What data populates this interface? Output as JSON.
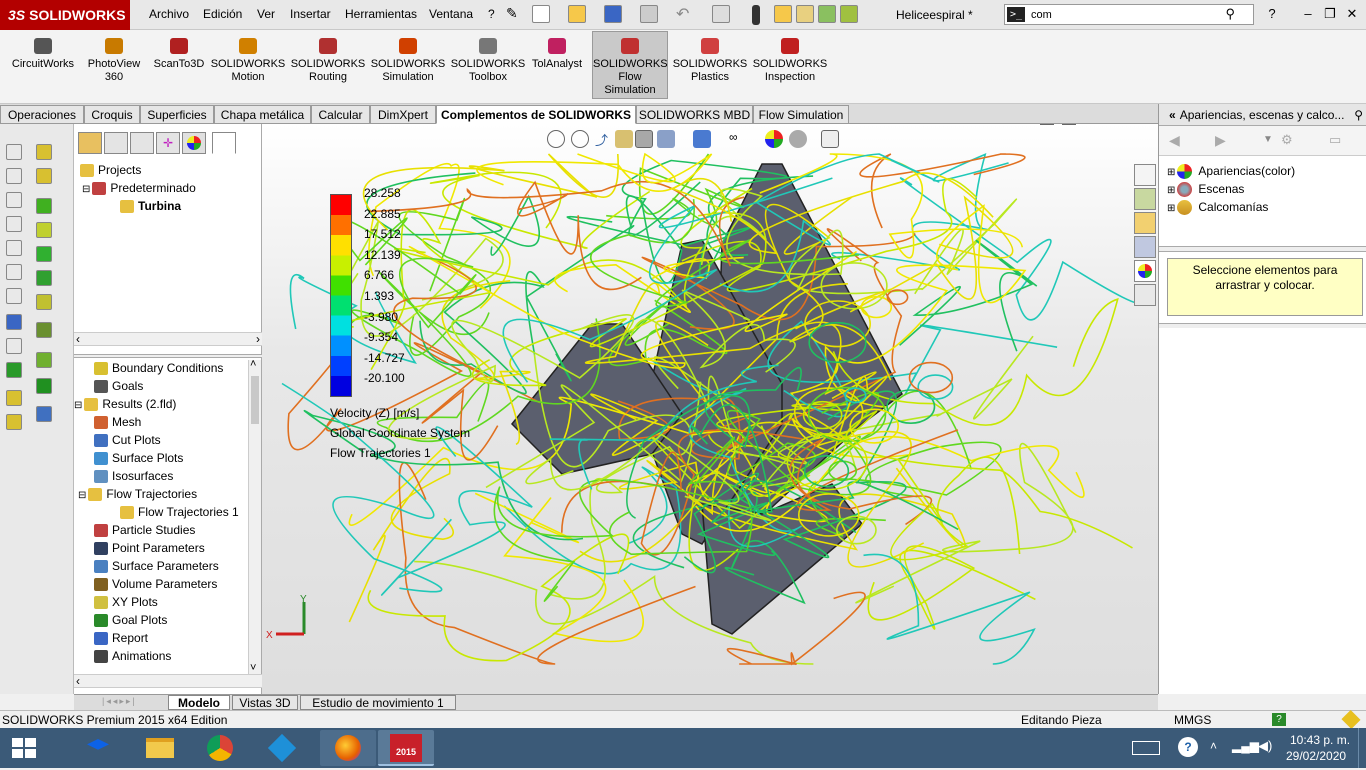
{
  "app": {
    "logo": "SOLIDWORKS",
    "doc_title": "Heliceespiral *"
  },
  "menu": [
    "Archivo",
    "Edición",
    "Ver",
    "Insertar",
    "Herramientas",
    "Ventana",
    "?"
  ],
  "search": {
    "value": "com",
    "prompt": ">_"
  },
  "ribbon": [
    {
      "label": "CircuitWorks",
      "color": "#555555"
    },
    {
      "label": "PhotoView 360",
      "color": "#c87a00"
    },
    {
      "label": "ScanTo3D",
      "color": "#b02020"
    },
    {
      "label": "SOLIDWORKS Motion",
      "color": "#d08000"
    },
    {
      "label": "SOLIDWORKS Routing",
      "color": "#b03030"
    },
    {
      "label": "SOLIDWORKS Simulation",
      "color": "#d04000"
    },
    {
      "label": "SOLIDWORKS Toolbox",
      "color": "#777777"
    },
    {
      "label": "TolAnalyst",
      "color": "#c02060"
    },
    {
      "label": "SOLIDWORKS Flow Simulation",
      "color": "#c03030",
      "active": true
    },
    {
      "label": "SOLIDWORKS Plastics",
      "color": "#d04040"
    },
    {
      "label": "SOLIDWORKS Inspection",
      "color": "#c02020"
    }
  ],
  "tabs": [
    {
      "label": "Operaciones"
    },
    {
      "label": "Croquis"
    },
    {
      "label": "Superficies"
    },
    {
      "label": "Chapa metálica"
    },
    {
      "label": "Calcular"
    },
    {
      "label": "DimXpert"
    },
    {
      "label": "Complementos de SOLIDWORKS",
      "active": true
    },
    {
      "label": "SOLIDWORKS MBD"
    },
    {
      "label": "Flow Simulation"
    }
  ],
  "project_tree": {
    "root": "Projects",
    "config": "Predeterminado",
    "project": "Turbina"
  },
  "analysis_tree": [
    {
      "label": "Boundary Conditions",
      "indent": 1
    },
    {
      "label": "Goals",
      "indent": 1
    },
    {
      "label": "Results (2.fld)",
      "indent": 0
    },
    {
      "label": "Mesh",
      "indent": 1
    },
    {
      "label": "Cut Plots",
      "indent": 1
    },
    {
      "label": "Surface Plots",
      "indent": 1
    },
    {
      "label": "Isosurfaces",
      "indent": 1
    },
    {
      "label": "Flow Trajectories",
      "indent": 1
    },
    {
      "label": "Flow Trajectories 1",
      "indent": 2
    },
    {
      "label": "Particle Studies",
      "indent": 1
    },
    {
      "label": "Point Parameters",
      "indent": 1
    },
    {
      "label": "Surface Parameters",
      "indent": 1
    },
    {
      "label": "Volume Parameters",
      "indent": 1
    },
    {
      "label": "XY Plots",
      "indent": 1
    },
    {
      "label": "Goal Plots",
      "indent": 1
    },
    {
      "label": "Report",
      "indent": 1
    },
    {
      "label": "Animations",
      "indent": 1
    }
  ],
  "legend": {
    "values": [
      "28.258",
      "22.885",
      "17.512",
      "12.139",
      "6.766",
      "1.393",
      "-3.980",
      "-9.354",
      "-14.727",
      "-20.100"
    ],
    "colors": [
      "#ff0000",
      "#ff7000",
      "#ffe000",
      "#c8f000",
      "#40e000",
      "#00e070",
      "#00e0e0",
      "#0090ff",
      "#0040ff",
      "#0000e0"
    ],
    "lines": [
      "Velocity (Z) [m/s]",
      "Global Coordinate System",
      "Flow Trajectories 1"
    ]
  },
  "triad": {
    "y": "Y",
    "x": "X"
  },
  "right_pane": {
    "title": "Apariencias, escenas y calco...",
    "items": [
      "Apariencias(color)",
      "Escenas",
      "Calcomanías"
    ],
    "hint": "Seleccione elementos para arrastrar y colocar."
  },
  "bottom_tabs": [
    {
      "label": "Modelo",
      "active": true
    },
    {
      "label": "Vistas 3D"
    },
    {
      "label": "Estudio de movimiento 1"
    }
  ],
  "status": {
    "product": "SOLIDWORKS Premium 2015 x64 Edition",
    "mode": "Editando Pieza",
    "units": "MMGS"
  },
  "taskbar": {
    "time": "10:43 p. m.",
    "date": "29/02/2020",
    "sw_badge": "2015"
  }
}
